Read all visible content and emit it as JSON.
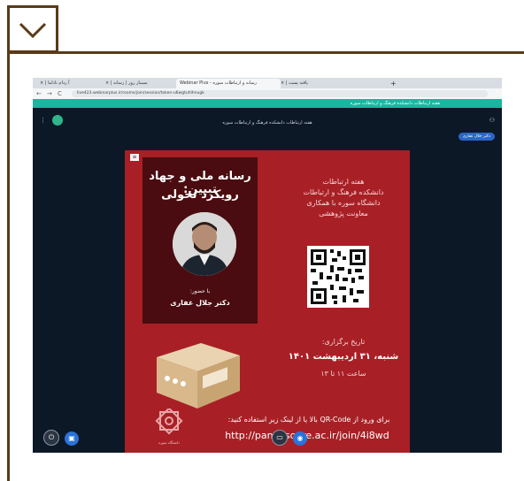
{
  "browser": {
    "tabs": [
      {
        "label": "× | آ ردام ناداما"
      },
      {
        "label": "× | بسیناز روز | رسانه"
      },
      {
        "label": "Webinar Plus - رسانه و ارتباطات سوره"
      },
      {
        "label": "× | یافته پست"
      },
      {
        "label": "+"
      }
    ],
    "back": "←",
    "forward": "→",
    "reload": "C",
    "url": "live423.webinarplus.ir/rooms/join/session/token-u6wgtuhlhnugk"
  },
  "banner": {
    "text": "هفته ارتباطات دانشکده فرهنگ و ارتباطات سوره"
  },
  "room": {
    "title": "هفته ارتباطات دانشکده فرهنگ و ارتباطات سوره",
    "presenter_chip": "دکتر جلال غفاری",
    "menu_icon": "⋮",
    "people_icon": "⚇"
  },
  "slide": {
    "menu": "≡",
    "title_line1": "رسانه ملی و جهاد تبیین:",
    "title_line2": "رویکرد تحولی",
    "with_label": "با حضور:",
    "speaker": "دکتر جلال غفاری",
    "event_lines": [
      "هفته ارتباطات",
      "دانشکده فرهنگ و ارتباطات",
      "دانشگاه سوره با همکاری",
      "معاونت پژوهشی"
    ],
    "date_label": "تاریخ برگزاری:",
    "date": "شنبه، ۳۱ اردیبهشت ۱۴۰۱",
    "time": "ساعت ۱۱ تا ۱۳",
    "instructions": "برای ورود از QR-Code بالا یا از لینک زیر استفاده کنید:",
    "link": "http://panel.soore.ac.ir/join/4i8wd",
    "university_label": "دانشگاه سوره"
  },
  "controls": {
    "left": [
      "⏻",
      "▣"
    ],
    "center": [
      "▭",
      "◉"
    ]
  },
  "colors": {
    "frame": "#5a3a18",
    "slide_red": "#a82026",
    "slide_dark": "#4a0c10",
    "accent_teal": "#19b79f",
    "room_bg": "#0d1826"
  }
}
